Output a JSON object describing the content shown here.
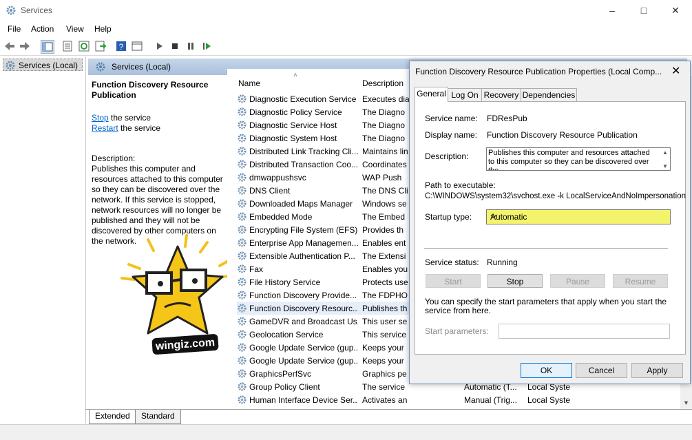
{
  "window": {
    "title": "Services"
  },
  "menu": [
    "File",
    "Action",
    "View",
    "Help"
  ],
  "tree": {
    "root": "Services (Local)"
  },
  "pane": {
    "header": "Services (Local)"
  },
  "details": {
    "service_title": "Function Discovery Resource Publication",
    "stop_link": "Stop",
    "stop_rest": " the service",
    "restart_link": "Restart",
    "restart_rest": " the service",
    "desc_label": "Description:",
    "desc_text": "Publishes this computer and resources attached to this computer so they can be discovered over the network.  If this service is stopped, network resources will no longer be published and they will not be discovered by other computers on the network."
  },
  "list": {
    "columns": {
      "name": "Name",
      "description": "Description"
    },
    "rows": [
      {
        "name": "Diagnostic Execution Service",
        "desc": "Executes diag",
        "status": "",
        "logon": ""
      },
      {
        "name": "Diagnostic Policy Service",
        "desc": "The Diagno",
        "status": "",
        "logon": ""
      },
      {
        "name": "Diagnostic Service Host",
        "desc": "The Diagno",
        "status": "",
        "logon": ""
      },
      {
        "name": "Diagnostic System Host",
        "desc": "The Diagno",
        "status": "",
        "logon": ""
      },
      {
        "name": "Distributed Link Tracking Cli...",
        "desc": "Maintains lin",
        "status": "",
        "logon": ""
      },
      {
        "name": "Distributed Transaction Coo...",
        "desc": "Coordinates",
        "status": "",
        "logon": ""
      },
      {
        "name": "dmwappushsvc",
        "desc": "WAP Push",
        "status": "",
        "logon": ""
      },
      {
        "name": "DNS Client",
        "desc": "The DNS Cli",
        "status": "",
        "logon": ""
      },
      {
        "name": "Downloaded Maps Manager",
        "desc": "Windows se",
        "status": "",
        "logon": ""
      },
      {
        "name": "Embedded Mode",
        "desc": "The Embed",
        "status": "",
        "logon": ""
      },
      {
        "name": "Encrypting File System (EFS)",
        "desc": "Provides th",
        "status": "",
        "logon": ""
      },
      {
        "name": "Enterprise App Managemen...",
        "desc": "Enables ent",
        "status": "",
        "logon": ""
      },
      {
        "name": "Extensible Authentication P...",
        "desc": "The Extensi",
        "status": "",
        "logon": ""
      },
      {
        "name": "Fax",
        "desc": "Enables you",
        "status": "",
        "logon": ""
      },
      {
        "name": "File History Service",
        "desc": "Protects use",
        "status": "",
        "logon": ""
      },
      {
        "name": "Function Discovery Provide...",
        "desc": "The FDPHO",
        "status": "",
        "logon": ""
      },
      {
        "name": "Function Discovery Resourc...",
        "desc": "Publishes th",
        "status": "",
        "logon": ""
      },
      {
        "name": "GameDVR and Broadcast Us...",
        "desc": "This user se",
        "status": "",
        "logon": ""
      },
      {
        "name": "Geolocation Service",
        "desc": "This service",
        "status": "",
        "logon": ""
      },
      {
        "name": "Google Update Service (gup...",
        "desc": "Keeps your",
        "status": "",
        "logon": ""
      },
      {
        "name": "Google Update Service (gup...",
        "desc": "Keeps your",
        "status": "",
        "logon": ""
      },
      {
        "name": "GraphicsPerfSvc",
        "desc": "Graphics pe",
        "status": "",
        "logon": ""
      },
      {
        "name": "Group Policy Client",
        "desc": "The service",
        "status": "Automatic (T...",
        "logon": "Local Syste"
      },
      {
        "name": "Human Interface Device Ser...",
        "desc": "Activates an",
        "status": "Manual (Trig...",
        "logon": "Local Syste"
      }
    ]
  },
  "bottom_tabs": [
    "Extended",
    "Standard"
  ],
  "dialog": {
    "title": "Function Discovery Resource Publication Properties (Local Comp...",
    "tabs": [
      "General",
      "Log On",
      "Recovery",
      "Dependencies"
    ],
    "service_name_label": "Service name:",
    "service_name": "FDResPub",
    "display_name_label": "Display name:",
    "display_name": "Function Discovery Resource Publication",
    "description_label": "Description:",
    "description": "Publishes this computer and resources attached to this computer so they can be discovered over the",
    "path_label": "Path to executable:",
    "path": "C:\\WINDOWS\\system32\\svchost.exe -k LocalServiceAndNoImpersonation",
    "startup_label": "Startup type:",
    "startup_value": "Automatic",
    "status_label": "Service status:",
    "status_value": "Running",
    "buttons": {
      "start": "Start",
      "stop": "Stop",
      "pause": "Pause",
      "resume": "Resume"
    },
    "hint": "You can specify the start parameters that apply when you start the service from here.",
    "params_label": "Start parameters:",
    "ok": "OK",
    "cancel": "Cancel",
    "apply": "Apply"
  },
  "watermark": {
    "text": "wingiz.com"
  }
}
